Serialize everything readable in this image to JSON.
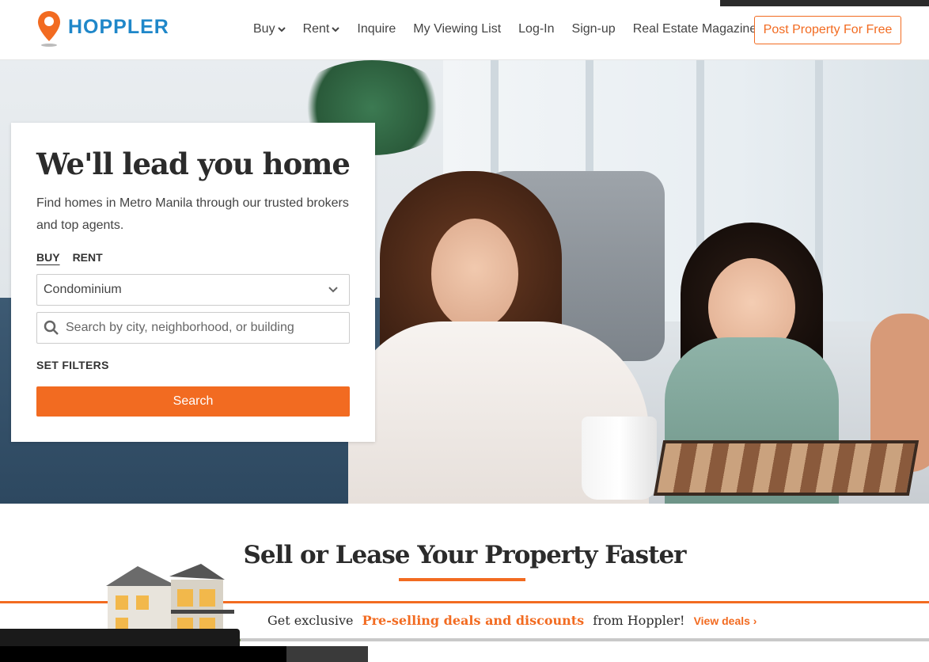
{
  "brand": {
    "name": "HOPPLER",
    "accent": "#f26b21",
    "logo_color": "#1f87c9"
  },
  "nav": {
    "items": [
      {
        "label": "Buy",
        "has_dropdown": true
      },
      {
        "label": "Rent",
        "has_dropdown": true
      },
      {
        "label": "Inquire",
        "has_dropdown": false
      },
      {
        "label": "My Viewing List",
        "has_dropdown": false
      },
      {
        "label": "Log-In",
        "has_dropdown": false
      },
      {
        "label": "Sign-up",
        "has_dropdown": false
      },
      {
        "label": "Real Estate Magazine",
        "has_dropdown": false
      }
    ],
    "post_button": "Post Property For Free"
  },
  "hero": {
    "title": "We'll lead you home",
    "subtitle": "Find homes in Metro Manila through our trusted brokers and top agents.",
    "tabs": [
      {
        "label": "BUY",
        "active": true
      },
      {
        "label": "RENT",
        "active": false
      }
    ],
    "property_type": "Condominium",
    "search_placeholder": "Search by city, neighborhood, or building",
    "filters_label": "SET FILTERS",
    "search_button": "Search"
  },
  "sell": {
    "title": "Sell or Lease Your Property Faster",
    "deals_prefix": "Get exclusive",
    "deals_highlight": "Pre-selling deals and discounts",
    "deals_suffix": "from Hoppler!",
    "view_deals": "View deals ›"
  }
}
